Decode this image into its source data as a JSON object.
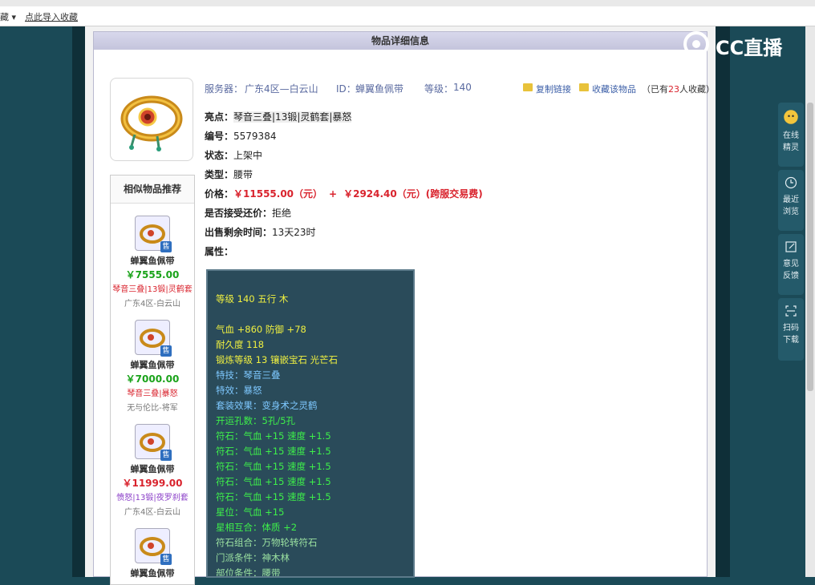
{
  "browser": {
    "bookmark_left": "藏 ▾",
    "bookmark_import": "点此导入收藏"
  },
  "overlay": {
    "logo_text": "CC直播",
    "sidebar": [
      {
        "label_line1": "在线",
        "label_line2": "精灵"
      },
      {
        "label_line1": "最近",
        "label_line2": "浏览"
      },
      {
        "label_line1": "意见",
        "label_line2": "反馈"
      },
      {
        "label_line1": "扫码",
        "label_line2": "下载"
      }
    ]
  },
  "panel": {
    "title": "物品详细信息"
  },
  "item": {
    "server_label": "服务器：",
    "server_value": "广东4区—白云山",
    "id_label": "ID：",
    "id_value": "蝉翼鱼佩带",
    "level_label": "等级：",
    "level_value": "140",
    "copy_link": "复制链接",
    "favorite": "收藏该物品",
    "fav_count_prefix": "（已有",
    "fav_count": "23",
    "fav_count_suffix": "人收藏）",
    "highlight_label": "亮点：",
    "highlight_value": "琴音三叠|13锻|灵鹤套|暴怒",
    "number_label": "编号：",
    "number_value": "5579384",
    "status_label": "状态：",
    "status_value": "上架中",
    "type_label": "类型：",
    "type_value": "腰带",
    "price_label": "价格：",
    "price_value": "￥11555.00（元）",
    "price_plus": "+",
    "price_extra": "￥2924.40（元）(跨服交易费)",
    "bargain_label": "是否接受还价：",
    "bargain_value": "拒绝",
    "remaining_label": "出售剩余时间：",
    "remaining_value": "13天23时",
    "attr_label": "属性："
  },
  "attributes": [
    {
      "text": "等级 140  五行 木",
      "color": "yellow"
    },
    {
      "text": "气血 +860 防御 +78",
      "color": "yellow"
    },
    {
      "text": "耐久度 118",
      "color": "yellow"
    },
    {
      "text": "锻炼等级 13 镶嵌宝石 光芒石",
      "color": "yellow"
    },
    {
      "text": "特技：琴音三叠",
      "color": "cyan"
    },
    {
      "text": "特效：暴怒",
      "color": "cyan"
    },
    {
      "text": "套装效果：变身术之灵鹤",
      "color": "cyan"
    },
    {
      "text": "开运孔数：5孔/5孔",
      "color": "green"
    },
    {
      "text": "符石：气血 +15 速度 +1.5",
      "color": "green"
    },
    {
      "text": "符石：气血 +15 速度 +1.5",
      "color": "green"
    },
    {
      "text": "符石：气血 +15 速度 +1.5",
      "color": "green"
    },
    {
      "text": "符石：气血 +15 速度 +1.5",
      "color": "green"
    },
    {
      "text": "符石：气血 +15 速度 +1.5",
      "color": "green"
    },
    {
      "text": "星位：气血 +15",
      "color": "green"
    },
    {
      "text": "星相互合：体质 +2",
      "color": "green"
    },
    {
      "text": "符石组合：万物轮转符石",
      "color": "greenish"
    },
    {
      "text": "门派条件：神木林",
      "color": "greenish"
    },
    {
      "text": "部位条件：腰带",
      "color": "greenish"
    }
  ],
  "similar": {
    "title": "相似物品推荐",
    "items": [
      {
        "name": "蝉翼鱼佩带",
        "price": "￥7555.00",
        "tags": "琴音三叠|13锻|灵鹤套",
        "server": "广东4区-白云山",
        "badge": "售"
      },
      {
        "name": "蝉翼鱼佩带",
        "price": "￥7000.00",
        "tags": "琴音三叠|暴怒",
        "server": "无与伦比-将军",
        "badge": "售"
      },
      {
        "name": "蝉翼鱼佩带",
        "price": "￥11999.00",
        "tags": "愤怒|13锻|夜罗刹套",
        "server": "广东4区-白云山",
        "badge": "售"
      },
      {
        "name": "蝉翼鱼佩带",
        "price": "",
        "tags": "",
        "server": "",
        "badge": "售"
      }
    ]
  },
  "colors": {
    "accent_blue": "#5a6aa0",
    "price_red": "#d9232d",
    "attr_bg": "#2a4b5a",
    "attr_yellow": "#f0f040",
    "attr_cyan": "#7ec8ff",
    "attr_green": "#3ef04a"
  }
}
